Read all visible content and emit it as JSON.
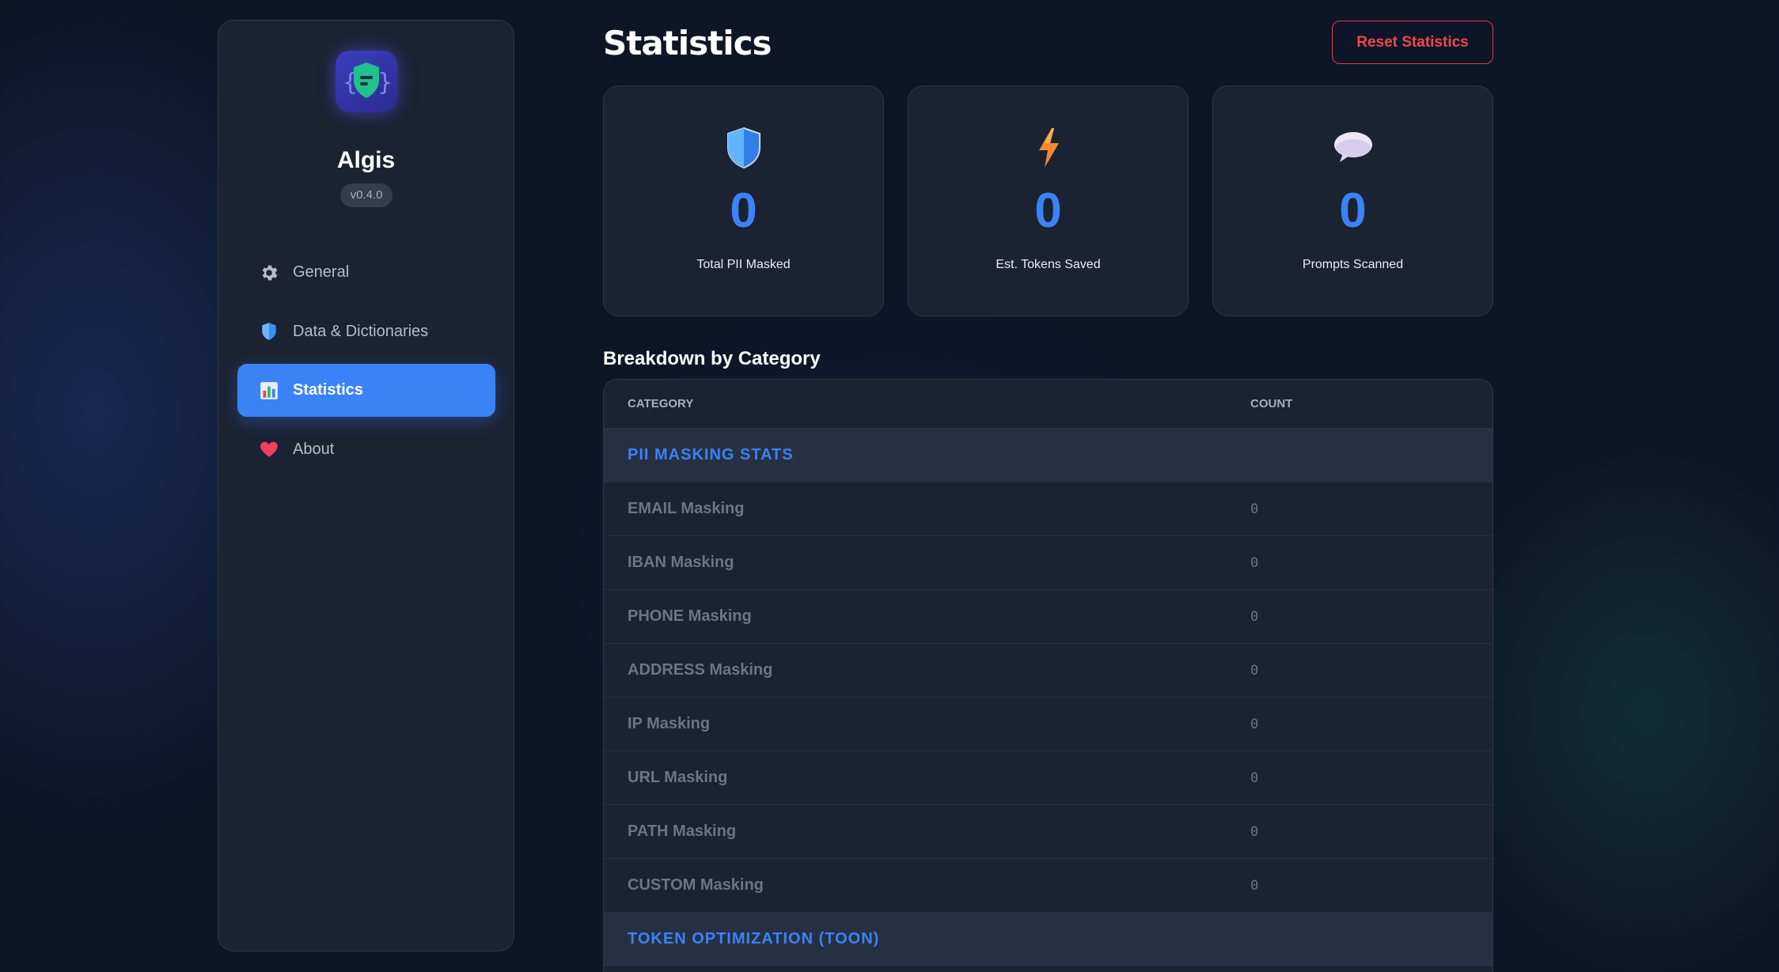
{
  "app": {
    "name": "Algis",
    "version": "v0.4.0"
  },
  "nav": {
    "items": [
      {
        "label": "General",
        "icon": "gear-icon"
      },
      {
        "label": "Data & Dictionaries",
        "icon": "shield-icon"
      },
      {
        "label": "Statistics",
        "icon": "bar-chart-icon",
        "active": true
      },
      {
        "label": "About",
        "icon": "heart-icon"
      }
    ]
  },
  "header": {
    "title": "Statistics",
    "reset_label": "Reset Statistics"
  },
  "stats": [
    {
      "value": "0",
      "label": "Total PII Masked",
      "icon": "shield-icon"
    },
    {
      "value": "0",
      "label": "Est. Tokens Saved",
      "icon": "lightning-icon"
    },
    {
      "value": "0",
      "label": "Prompts Scanned",
      "icon": "speech-bubble-icon"
    }
  ],
  "breakdown": {
    "title": "Breakdown by Category",
    "columns": [
      "CATEGORY",
      "COUNT"
    ],
    "groups": [
      {
        "name": "PII MASKING STATS",
        "rows": [
          {
            "category": "EMAIL Masking",
            "count": "0"
          },
          {
            "category": "IBAN Masking",
            "count": "0"
          },
          {
            "category": "PHONE Masking",
            "count": "0"
          },
          {
            "category": "ADDRESS Masking",
            "count": "0"
          },
          {
            "category": "IP Masking",
            "count": "0"
          },
          {
            "category": "URL Masking",
            "count": "0"
          },
          {
            "category": "PATH Masking",
            "count": "0"
          },
          {
            "category": "CUSTOM Masking",
            "count": "0"
          }
        ]
      },
      {
        "name": "TOKEN OPTIMIZATION (TOON)",
        "rows": []
      }
    ]
  },
  "colors": {
    "accent": "#3b82f6",
    "danger": "#f0474f",
    "panel": "#1b2232",
    "background": "#0e1527"
  }
}
